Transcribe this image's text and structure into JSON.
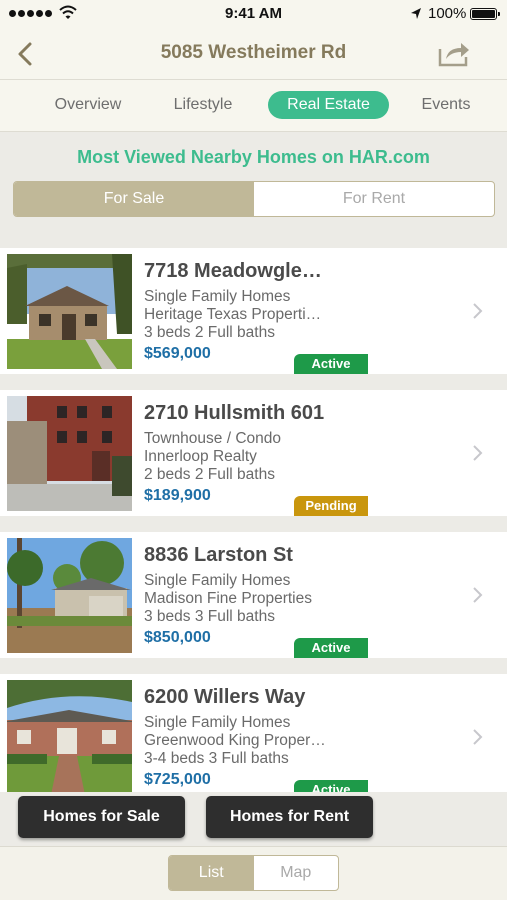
{
  "status_bar": {
    "time": "9:41 AM",
    "battery": "100%"
  },
  "nav": {
    "title": "5085 Westheimer Rd",
    "back_icon": "chevron-left-icon",
    "share_icon": "share-icon"
  },
  "tabs": [
    {
      "label": "Overview",
      "active": false
    },
    {
      "label": "Lifestyle",
      "active": false
    },
    {
      "label": "Real Estate",
      "active": true
    },
    {
      "label": "Events",
      "active": false
    }
  ],
  "headline": "Most Viewed Nearby Homes on HAR.com",
  "sale_rent_toggle": {
    "sale": "For Sale",
    "rent": "For Rent",
    "selected": "For Sale"
  },
  "listings": [
    {
      "address": "7718 Meadowgle…",
      "type": "Single Family Homes",
      "broker": "Heritage Texas Properti…",
      "beds_baths": "3 beds 2 Full baths",
      "price": "$569,000",
      "status": "Active",
      "status_color": "#1e9a49"
    },
    {
      "address": "2710 Hullsmith 601",
      "type": "Townhouse / Condo",
      "broker": "Innerloop Realty",
      "beds_baths": "2 beds 2 Full baths",
      "price": "$189,900",
      "status": "Pending",
      "status_color": "#c9960d"
    },
    {
      "address": "8836 Larston St",
      "type": "Single Family Homes",
      "broker": "Madison Fine Properties",
      "beds_baths": "3 beds 3 Full baths",
      "price": "$850,000",
      "status": "Active",
      "status_color": "#1e9a49"
    },
    {
      "address": "6200 Willers Way",
      "type": "Single Family Homes",
      "broker": "Greenwood King Proper…",
      "beds_baths": "3-4 beds 3 Full baths",
      "price": "$725,000",
      "status": "Active",
      "status_color": "#1e9a49"
    }
  ],
  "actions": {
    "homes_for_sale": "Homes for Sale",
    "homes_for_rent": "Homes for Rent"
  },
  "view_toggle": {
    "list": "List",
    "map": "Map",
    "selected": "List"
  },
  "colors": {
    "accent_green": "#3dbc8e",
    "gold": "#c0b898",
    "price_blue": "#1f6fa6",
    "title_brown": "#857a5c"
  }
}
